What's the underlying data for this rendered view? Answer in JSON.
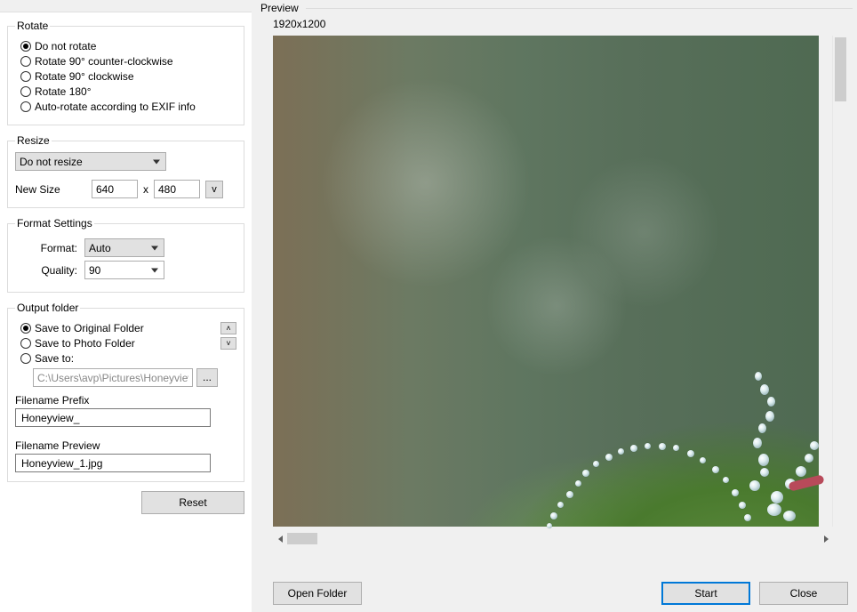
{
  "rotate": {
    "legend": "Rotate",
    "options": [
      "Do not rotate",
      "Rotate 90° counter-clockwise",
      "Rotate 90° clockwise",
      "Rotate 180°",
      "Auto-rotate according to EXIF info"
    ],
    "selected_index": 0
  },
  "resize": {
    "legend": "Resize",
    "mode": "Do not resize",
    "newsize_label": "New Size",
    "width": "640",
    "x": "x",
    "height": "480",
    "vbtn": "v"
  },
  "format": {
    "legend": "Format Settings",
    "format_label": "Format:",
    "format_value": "Auto",
    "quality_label": "Quality:",
    "quality_value": "90"
  },
  "output": {
    "legend": "Output folder",
    "options": [
      "Save to Original Folder",
      "Save to Photo Folder",
      "Save to:"
    ],
    "selected_index": 0,
    "path": "C:\\Users\\avp\\Pictures\\Honeyview",
    "browse": "...",
    "prefix_label": "Filename Prefix",
    "prefix_value": "Honeyview_",
    "preview_label": "Filename Preview",
    "preview_value": "Honeyview_1.jpg"
  },
  "reset_label": "Reset",
  "preview": {
    "legend": "Preview",
    "dimensions": "1920x1200",
    "nav_up": "˄",
    "nav_down": "˅"
  },
  "buttons": {
    "open": "Open Folder",
    "start": "Start",
    "close": "Close"
  }
}
